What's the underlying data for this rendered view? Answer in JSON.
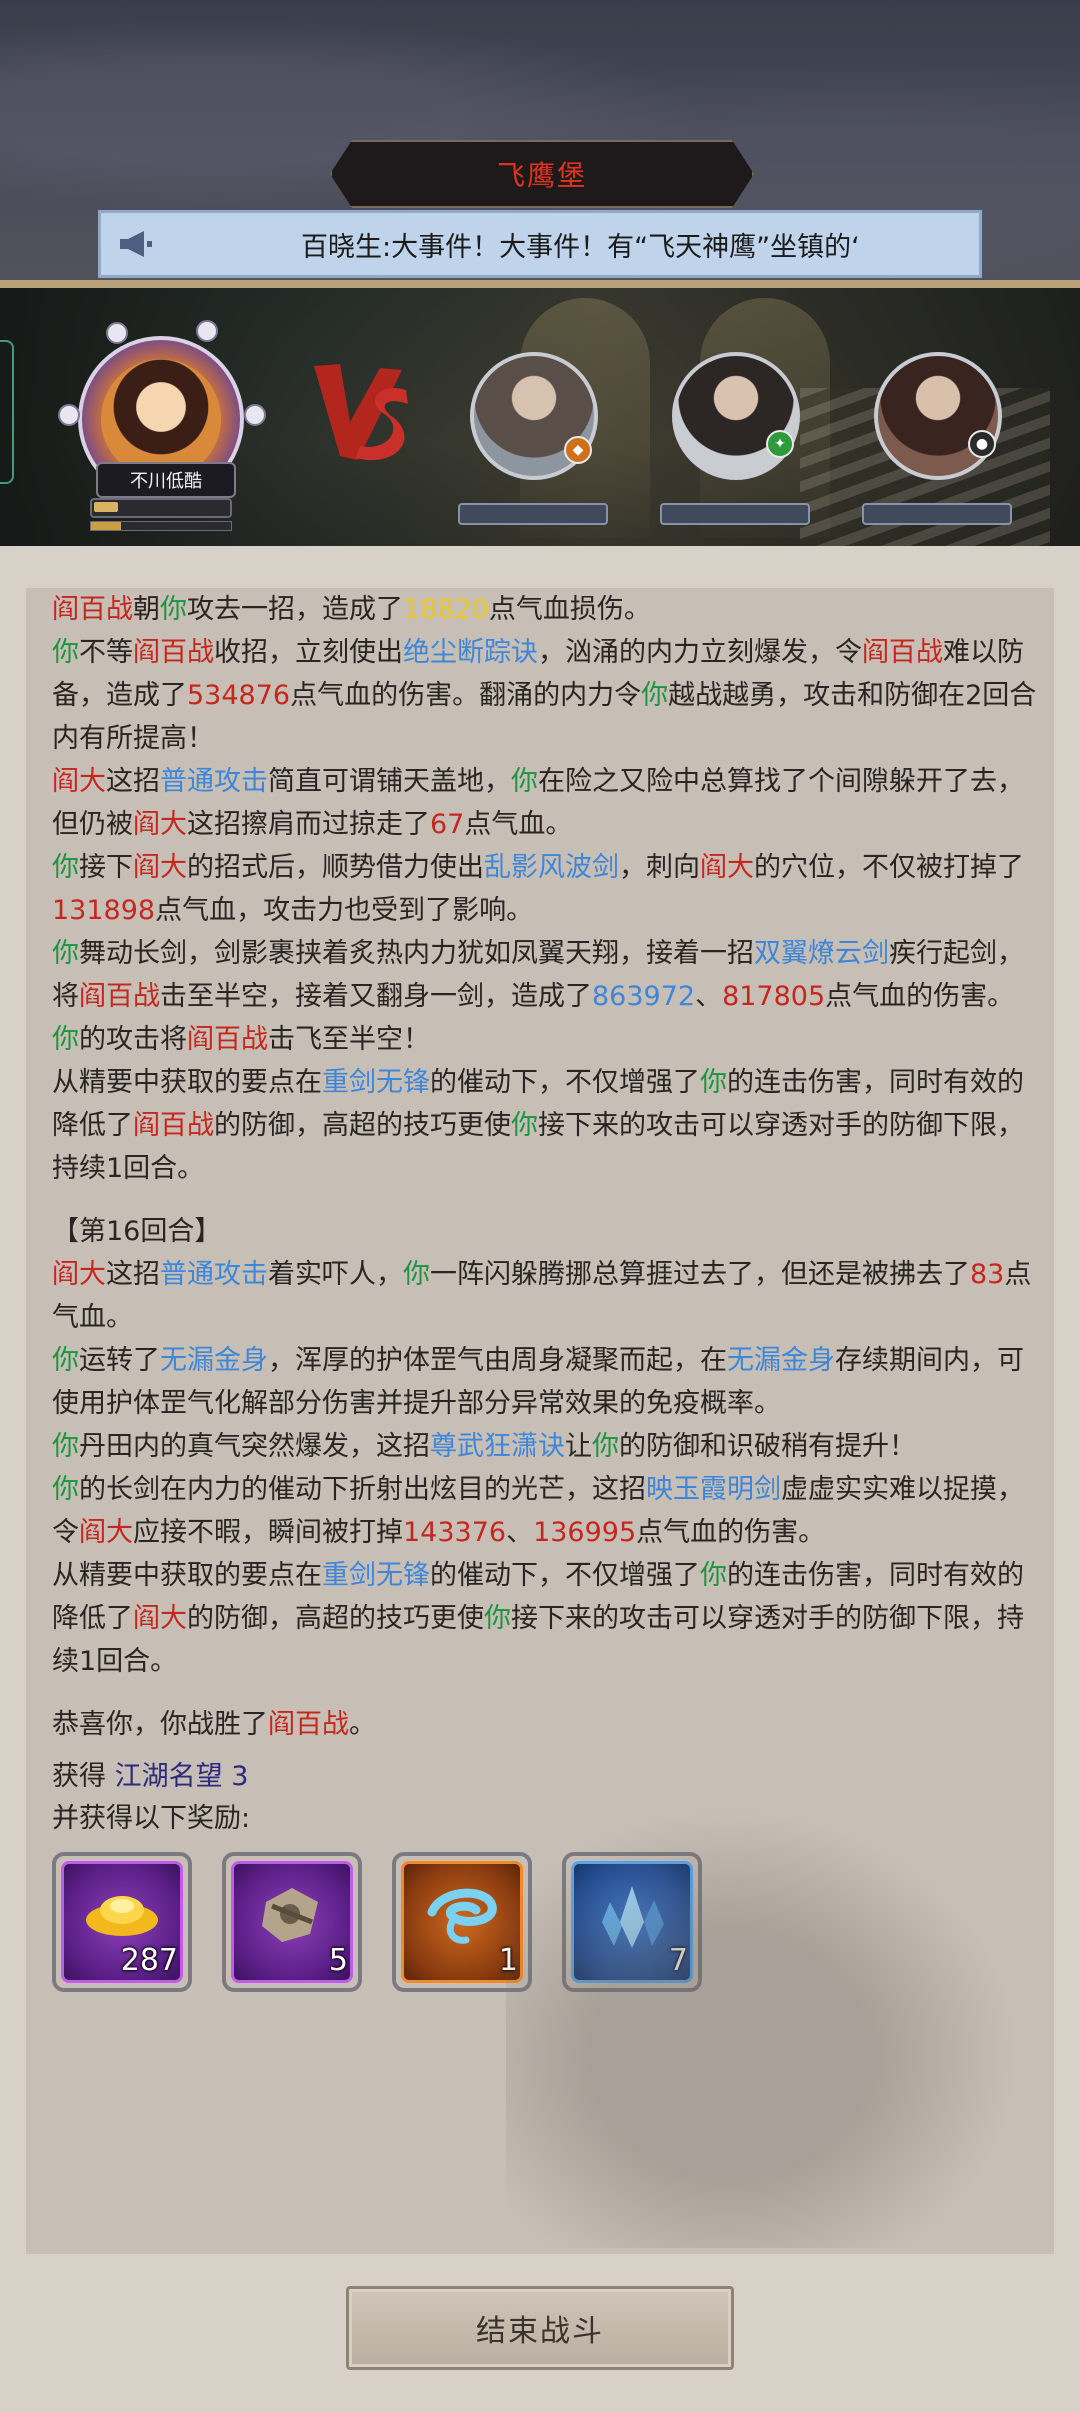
{
  "header": {
    "location_title": "飞鹰堡",
    "notice_text": "百晓生:大事件！大事件！有“飞天神鹰”坐镇的‘",
    "notice_icon": "megaphone-icon"
  },
  "battle": {
    "player_name": "不川低酷",
    "vs_label": "VS",
    "enemies": [
      {
        "name": "enemy-elder",
        "badge_color": "#d0701a"
      },
      {
        "name": "enemy-swordsman",
        "badge_color": "#2e9a3c"
      },
      {
        "name": "enemy-archer",
        "badge_color": "#2a2a2a"
      }
    ]
  },
  "log": {
    "lines": {
      "l0": [
        "阎百战",
        "朝",
        "你",
        "攻去一招，造成了",
        "18820",
        "点气血损伤。"
      ],
      "l1": [
        "你",
        "不等",
        "阎百战",
        "收招，立刻使出",
        "绝尘断踪诀",
        "，汹涌的内力立刻爆发，令",
        "阎百战",
        "难以防备，造成了",
        "534876",
        "点气血的伤害。翻涌的内力令",
        "你",
        "越战越勇，攻击和防御在2回合内有所提高！"
      ],
      "l2": [
        "阎大",
        "这招",
        "普通攻击",
        "简直可谓铺天盖地，",
        "你",
        "在险之又险中总算找了个间隙躲开了去，但仍被",
        "阎大",
        "这招擦肩而过掠走了",
        "67",
        "点气血。"
      ],
      "l3": [
        "你",
        "接下",
        "阎大",
        "的招式后，顺势借力使出",
        "乱影风波剑",
        "，刺向",
        "阎大",
        "的穴位，不仅被打掉了",
        "131898",
        "点气血，攻击力也受到了影响。"
      ],
      "l4": [
        "你",
        "舞动长剑，剑影裹挟着炙热内力犹如凤翼天翔，接着一招",
        "双翼燎云剑",
        "疾行起剑，将",
        "阎百战",
        "击至半空，接着又翻身一剑，造成了",
        "863972",
        "、",
        "817805",
        "点气血的伤害。"
      ],
      "l5": [
        "你",
        "的攻击将",
        "阎百战",
        "击飞至半空！"
      ],
      "l6": [
        "从精要中获取的要点在",
        "重剑无锋",
        "的催动下，不仅增强了",
        "你",
        "的连击伤害，同时有效的降低了",
        "阎百战",
        "的防御，高超的技巧更使",
        "你",
        "接下来的攻击可以穿透对手的防御下限，持续1回合。"
      ],
      "round": "【第16回合】",
      "l7": [
        "阎大",
        "这招",
        "普通攻击",
        "着实吓人，",
        "你",
        "一阵闪躲腾挪总算捱过去了，但还是被拂去了",
        "83",
        "点气血。"
      ],
      "l8": [
        "你",
        "运转了",
        "无漏金身",
        "，浑厚的护体罡气由周身凝聚而起，在",
        "无漏金身",
        "存续期间内，可使用护体罡气化解部分伤害并提升部分异常效果的免疫概率。"
      ],
      "l9": [
        "你",
        "丹田内的真气突然爆发，这招",
        "尊武狂潇诀",
        "让",
        "你",
        "的防御和识破稍有提升！"
      ],
      "l10": [
        "你",
        "的长剑在内力的催动下折射出炫目的光芒，这招",
        "映玉霞明剑",
        "虚虚实实难以捉摸，令",
        "阎大",
        "应接不暇，瞬间被打掉",
        "143376",
        "、",
        "136995",
        "点气血的伤害。"
      ],
      "l11": [
        "从精要中获取的要点在",
        "重剑无锋",
        "的催动下，不仅增强了",
        "你",
        "的连击伤害，同时有效的降低了",
        "阎大",
        "的防御，高超的技巧更使",
        "你",
        "接下来的攻击可以穿透对手的防御下限，持续1回合。"
      ],
      "victory": [
        "恭喜你，你战胜了",
        "阎百战",
        "。"
      ]
    },
    "colors": {
      "enemy": "#c5271f",
      "self": "#1d9440",
      "skill": "#3d86d8",
      "highlight": "#e8c72b"
    }
  },
  "rewards": {
    "obtain_label": "获得",
    "obtain_item": "江湖名望",
    "obtain_value": "3",
    "more_label": "并获得以下奖励:",
    "items": [
      {
        "icon": "gold-ingot-icon",
        "qty": "287",
        "rarity": "purple"
      },
      {
        "icon": "ancient-relic-icon",
        "qty": "5",
        "rarity": "purple"
      },
      {
        "icon": "blue-silk-icon",
        "qty": "1",
        "rarity": "orange"
      },
      {
        "icon": "blue-crystal-icon",
        "qty": "7",
        "rarity": "blue"
      }
    ]
  },
  "footer": {
    "end_battle_label": "结束战斗"
  }
}
